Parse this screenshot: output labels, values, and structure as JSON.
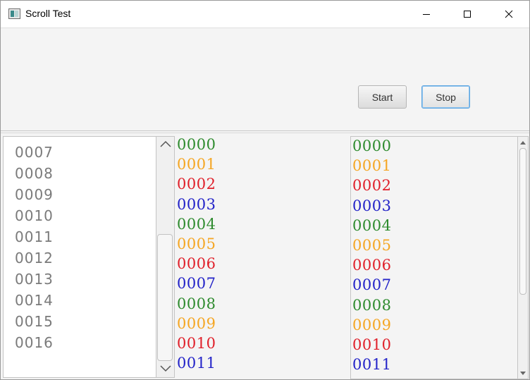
{
  "window": {
    "title": "Scroll Test",
    "icon": "app-window-icon",
    "controls": [
      "minimize-icon",
      "maximize-icon",
      "close-icon"
    ]
  },
  "toolbar": {
    "start_label": "Start",
    "stop_label": "Stop"
  },
  "list_left": {
    "items": [
      "0007",
      "0008",
      "0009",
      "0010",
      "0011",
      "0012",
      "0013",
      "0014",
      "0015",
      "0016"
    ],
    "text_color": "#7a7a7a"
  },
  "column_middle": {
    "items": [
      {
        "text": "0000",
        "color": "#2e8b2e"
      },
      {
        "text": "0001",
        "color": "#f5a623"
      },
      {
        "text": "0002",
        "color": "#e0202a"
      },
      {
        "text": "0003",
        "color": "#2323c8"
      },
      {
        "text": "0004",
        "color": "#2e8b2e"
      },
      {
        "text": "0005",
        "color": "#f5a623"
      },
      {
        "text": "0006",
        "color": "#e0202a"
      },
      {
        "text": "0007",
        "color": "#2323c8"
      },
      {
        "text": "0008",
        "color": "#2e8b2e"
      },
      {
        "text": "0009",
        "color": "#f5a623"
      },
      {
        "text": "0010",
        "color": "#e0202a"
      },
      {
        "text": "0011",
        "color": "#2323c8"
      }
    ]
  },
  "column_right": {
    "items": [
      {
        "text": "0000",
        "color": "#2e8b2e"
      },
      {
        "text": "0001",
        "color": "#f5a623"
      },
      {
        "text": "0002",
        "color": "#e0202a"
      },
      {
        "text": "0003",
        "color": "#2323c8"
      },
      {
        "text": "0004",
        "color": "#2e8b2e"
      },
      {
        "text": "0005",
        "color": "#f5a623"
      },
      {
        "text": "0006",
        "color": "#e0202a"
      },
      {
        "text": "0007",
        "color": "#2323c8"
      },
      {
        "text": "0008",
        "color": "#2e8b2e"
      },
      {
        "text": "0009",
        "color": "#f5a623"
      },
      {
        "text": "0010",
        "color": "#e0202a"
      },
      {
        "text": "0011",
        "color": "#2323c8"
      }
    ]
  }
}
